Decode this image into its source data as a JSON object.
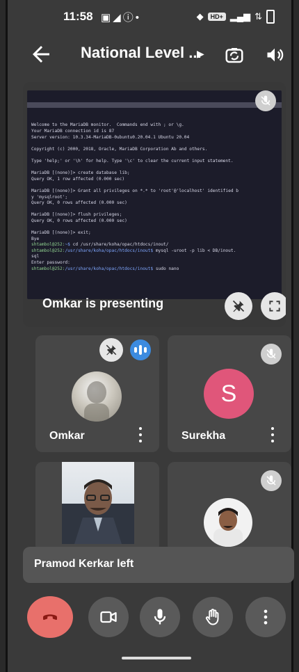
{
  "status_bar": {
    "time": "11:58",
    "network_badge": "HD+"
  },
  "header": {
    "title": "National Level ...",
    "back_icon": "arrow-left-icon",
    "switch_camera_icon": "switch-camera-icon",
    "speaker_icon": "speaker-icon"
  },
  "presentation": {
    "presenting_label": "Omkar is presenting",
    "terminal_lines": [
      "Welcome to the MariaDB monitor.  Commands end with ; or \\g.",
      "Your MariaDB connection id is 87",
      "Server version: 10.3.34-MariaDB-0ubuntu0.20.04.1 Ubuntu 20.04",
      "",
      "Copyright (c) 2000, 2018, Oracle, MariaDB Corporation Ab and others.",
      "",
      "Type 'help;' or '\\h' for help. Type '\\c' to clear the current input statement.",
      "",
      "MariaDB [(none)]> create database lib;",
      "Query OK, 1 row affected (0.000 sec)",
      "",
      "MariaDB [(none)]> Grant all privileges on *.* to 'root'@'localhost' identified b",
      "y 'mysqlroot';",
      "Query OK, 0 rows affected (0.000 sec)",
      "",
      "MariaDB [(none)]> flush privileges;",
      "Query OK, 0 rows affected (0.000 sec)",
      "",
      "MariaDB [(none)]> exit;",
      "Bye",
      "shtambol@252:~$ cd /usr/share/koha/opac/htdocs/inout/",
      "shtambol@252:/usr/share/koha/opac/htdocs/inout$ mysql -uroot -p lib < DB/inout.",
      "sql",
      "Enter password:",
      "shtambol@252:/usr/share/koha/opac/htdocs/inout$ sudo nano"
    ]
  },
  "participants": [
    {
      "name": "Omkar",
      "pinned": true,
      "speaking": true
    },
    {
      "name": "Surekha",
      "initial": "S",
      "muted": true,
      "avatar_color": "#e0567a"
    },
    {
      "name": "",
      "video_on": true
    },
    {
      "name": "",
      "muted": true
    }
  ],
  "toast": {
    "text": "Pramod Kerkar left"
  },
  "controls": {
    "end_call_color": "#e8706b",
    "buttons": [
      "end-call-icon",
      "video-camera-icon",
      "microphone-icon",
      "raise-hand-icon",
      "more-options-icon"
    ]
  }
}
